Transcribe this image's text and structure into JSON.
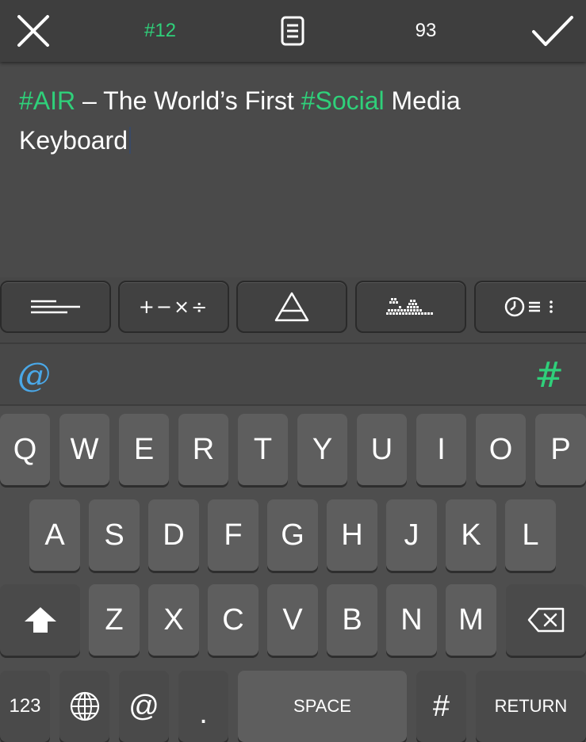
{
  "topbar": {
    "close_icon": "close-x-icon",
    "tag": "#12",
    "doc_icon": "document-icon",
    "count": "93",
    "check_icon": "checkmark-icon"
  },
  "editor": {
    "seg1": "#AIR",
    "seg2": " – The World’s First ",
    "seg3": "#Social",
    "seg4": " Media Keyboard",
    "hashtag_color": "#2fd07a"
  },
  "tools": [
    {
      "icon": "text-align-icon"
    },
    {
      "icon": "math-symbols-icon",
      "label": "+−×÷"
    },
    {
      "icon": "alchemy-triangle-icon"
    },
    {
      "icon": "pixel-art-icon"
    },
    {
      "icon": "clock-list-icon"
    }
  ],
  "suggest": {
    "left": "@",
    "right": "#",
    "left_color": "#4aa8e8",
    "right_color": "#2fd07a"
  },
  "keyboard": {
    "row1": [
      "Q",
      "W",
      "E",
      "R",
      "T",
      "Y",
      "U",
      "I",
      "O",
      "P"
    ],
    "row2": [
      "A",
      "S",
      "D",
      "F",
      "G",
      "H",
      "J",
      "K",
      "L"
    ],
    "row3": [
      "Z",
      "X",
      "C",
      "V",
      "B",
      "N",
      "M"
    ],
    "row4": {
      "numbers": "123",
      "globe_icon": "globe-icon",
      "at": "@",
      "period": ".",
      "space": "SPACE",
      "hash": "#",
      "return": "RETURN"
    },
    "shift_icon": "shift-arrow-icon",
    "delete_icon": "backspace-icon"
  }
}
